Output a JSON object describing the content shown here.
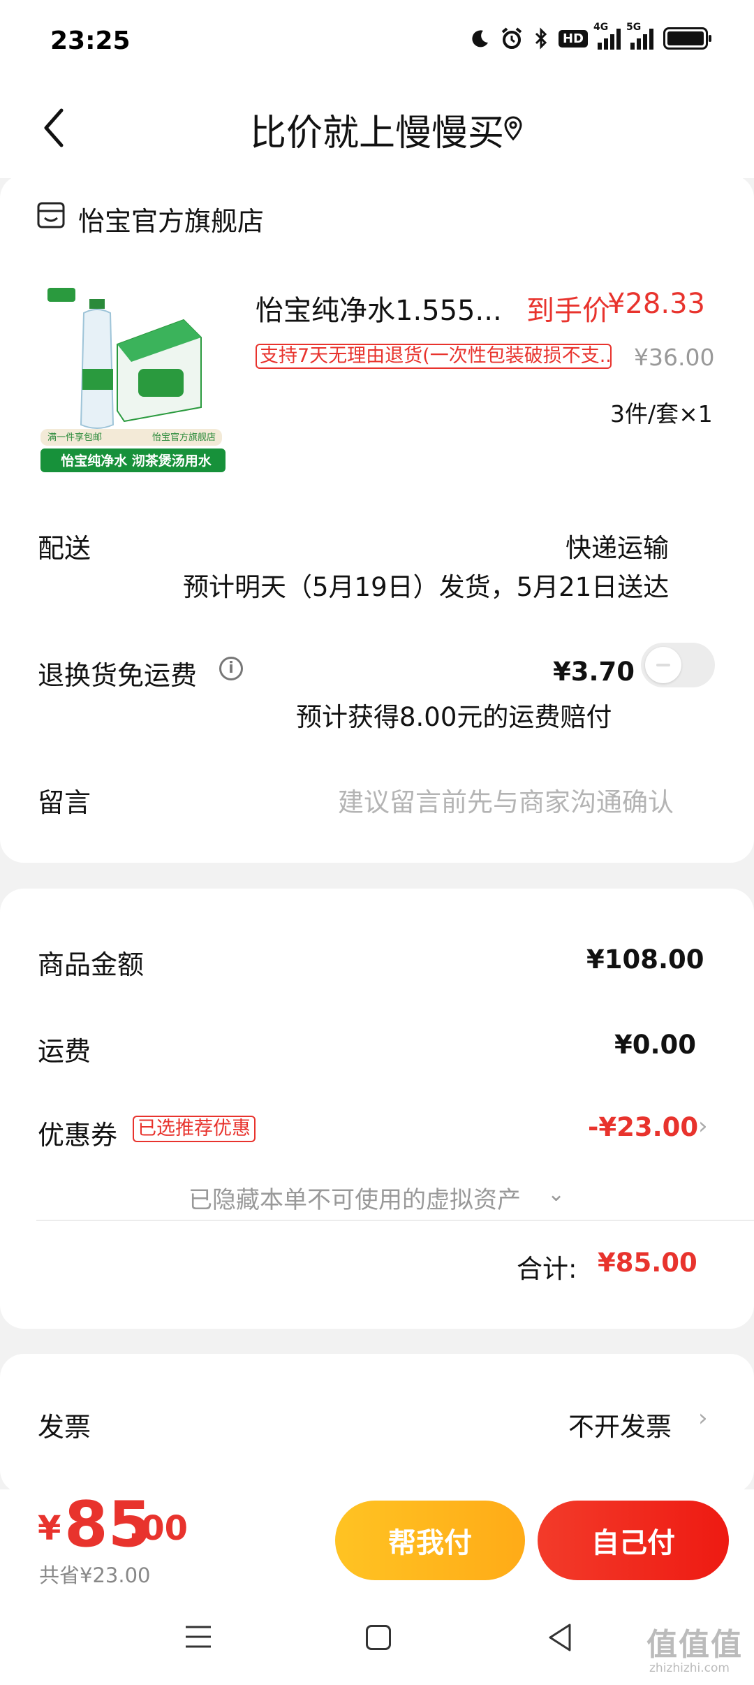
{
  "status_bar": {
    "time": "23:25",
    "icons": [
      "moon-icon",
      "alarm-icon",
      "bluetooth-icon",
      "hd-icon",
      "4g-signal-icon",
      "5g-signal-icon",
      "battery-icon"
    ],
    "hd_label": "HD",
    "net1": "4G",
    "net2": "5G"
  },
  "header": {
    "title": "比价就上慢慢买",
    "back_icon": "chevron-left-icon",
    "location_icon": "location-pin-icon"
  },
  "store": {
    "name": "怡宝官方旗舰店",
    "icon": "store-icon"
  },
  "product": {
    "name": "怡宝纯净水1.555...",
    "final_price_label": "到手价",
    "final_price": "¥28.33",
    "return_policy": "支持7天无理由退货(一次性包装破损不支...",
    "original_price": "¥36.00",
    "spec_qty": "3件/套×1",
    "image_banner": "怡宝纯净水 沏茶煲汤用水",
    "image_tag1": "满一件享包邮",
    "image_tag2": "怡宝官方旗舰店"
  },
  "delivery": {
    "label": "配送",
    "method": "快递运输",
    "estimate": "预计明天（5月19日）发货，5月21日送达"
  },
  "return_shipping": {
    "label": "退换货免运费",
    "price": "¥3.70",
    "note": "预计获得8.00元的运费赔付",
    "enabled": false
  },
  "message": {
    "label": "留言",
    "placeholder": "建议留言前先与商家沟通确认"
  },
  "summary": {
    "goods_label": "商品金额",
    "goods_value": "¥108.00",
    "shipping_label": "运费",
    "shipping_value": "¥0.00",
    "coupon_label": "优惠券",
    "coupon_tag": "已选推荐优惠",
    "coupon_value": "-¥23.00",
    "hidden_assets": "已隐藏本单不可使用的虚拟资产",
    "total_label": "合计:",
    "total_value": "¥85.00"
  },
  "invoice": {
    "label": "发票",
    "value": "不开发票"
  },
  "footer": {
    "currency": "¥",
    "amount_int": "85",
    "amount_dec": ".00",
    "saved": "共省¥23.00",
    "help_pay": "帮我付",
    "self_pay": "自己付"
  },
  "watermark": {
    "text": "值值值",
    "site": "zhizhizhi.com"
  },
  "colors": {
    "accent_red": "#e8332d",
    "help_yellow": "#ffb71f",
    "background": "#f2f2f2"
  }
}
